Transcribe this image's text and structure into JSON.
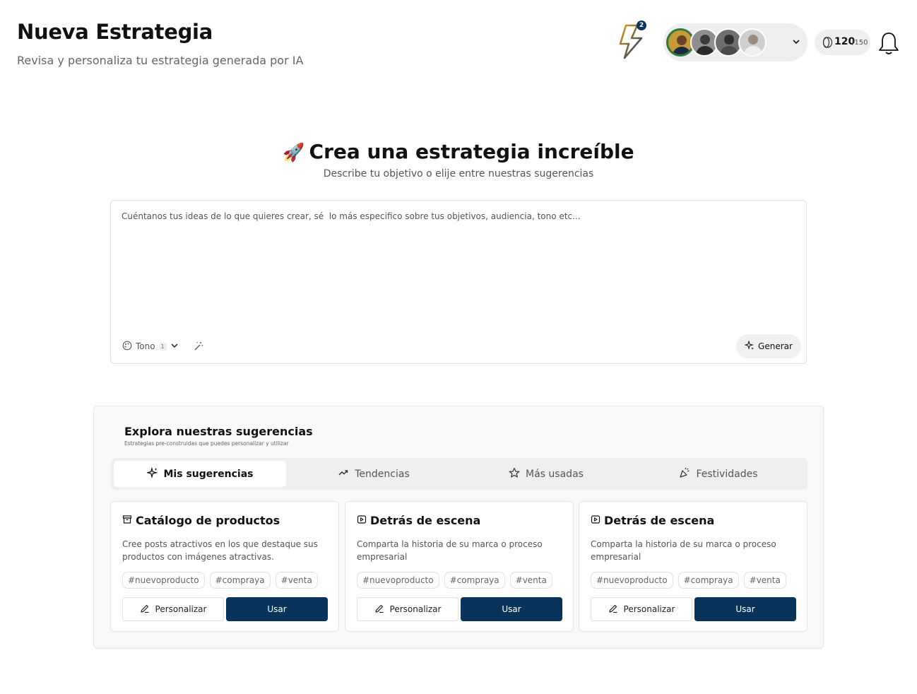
{
  "header": {
    "title": "Nueva Estrategia",
    "subtitle": "Revisa y personaliza tu estrategia generada por IA",
    "notifications_badge": "2",
    "credits_used": "120",
    "credits_max": "/150",
    "icons": [
      "lightning-icon",
      "chevron-down-icon",
      "coin-icon",
      "bell-icon"
    ]
  },
  "hero": {
    "emoji": "🚀",
    "title": "Crea una estrategia increíble",
    "subtitle": "Describe tu objetivo  o elije entre nuestras sugerencias"
  },
  "prompt": {
    "placeholder": "Cuéntanos tus ideas de lo que quieres crear, sé  lo más especifico sobre tus objetivos, audiencia, tono etc...",
    "value": "",
    "tone_label": "Tono",
    "tone_count": "1",
    "generate_label": "Generar"
  },
  "suggestions": {
    "title": "Explora nuestras sugerencias",
    "subtitle": "Estrategias pre-construidas que puedes personalizar y utilizar",
    "tabs": [
      {
        "label": "Mis sugerencias",
        "active": true
      },
      {
        "label": "Tendencias",
        "active": false
      },
      {
        "label": "Más usadas",
        "active": false
      },
      {
        "label": "Festividades",
        "active": false
      }
    ],
    "cards": [
      {
        "title": "Catálogo de productos",
        "icon": "archive-icon",
        "description": "Cree posts atractivos en los que destaque sus productos con imágenes atractivas.",
        "tags": [
          "#nuevoproducto",
          "#compraya",
          "#venta"
        ],
        "customize_label": "Personalizar",
        "use_label": "Usar"
      },
      {
        "title": "Detrás de escena",
        "icon": "play-icon",
        "description": "Comparta la historia de su marca o proceso empresarial",
        "tags": [
          "#nuevoproducto",
          "#compraya",
          "#venta"
        ],
        "customize_label": "Personalizar",
        "use_label": "Usar"
      },
      {
        "title": "Detrás de escena",
        "icon": "play-icon",
        "description": "Comparta la historia de su marca o proceso empresarial",
        "tags": [
          "#nuevoproducto",
          "#compraya",
          "#venta"
        ],
        "customize_label": "Personalizar",
        "use_label": "Usar"
      }
    ]
  },
  "colors": {
    "primary": "#08345c",
    "badge": "#0b3560",
    "panel_bg": "#f8f9fa",
    "active_avatar_ring": "#2d7a3a"
  }
}
